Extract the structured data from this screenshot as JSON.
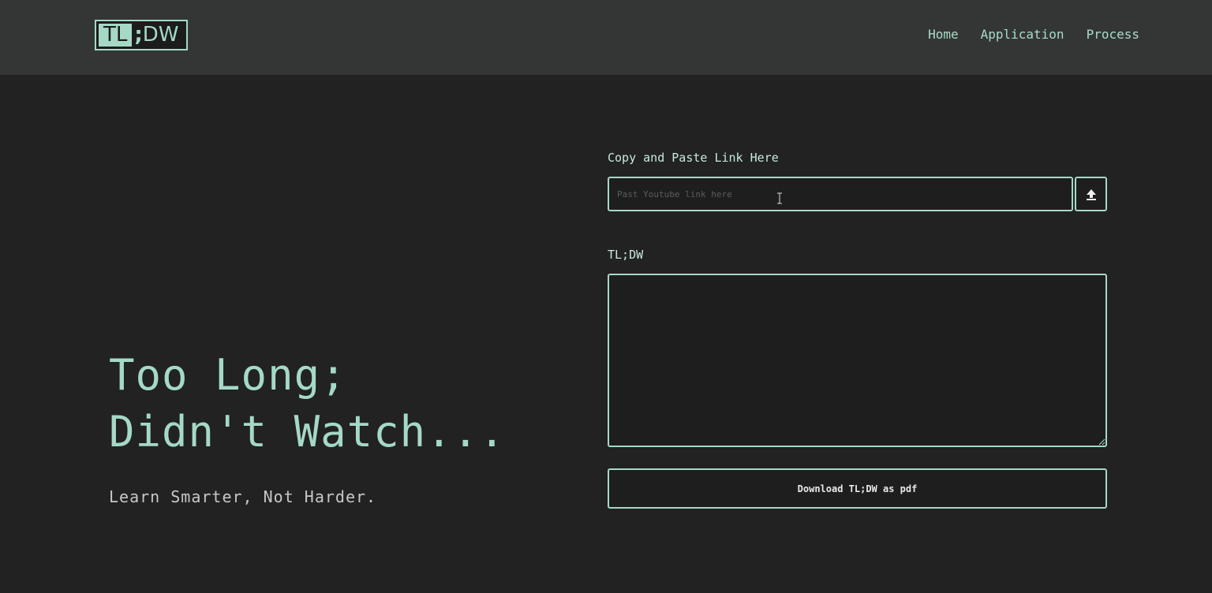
{
  "header": {
    "logo": {
      "left": "TL",
      "separator": ";",
      "right": "DW"
    },
    "nav": [
      "Home",
      "Application",
      "Process"
    ]
  },
  "hero": {
    "title": "Too Long;\nDidn't Watch...",
    "subtitle": "Learn Smarter, Not Harder."
  },
  "form": {
    "link_label": "Copy and Paste Link Here",
    "link_placeholder": "Past Youtube link here",
    "link_value": "",
    "upload_icon": "upload-arrow-icon",
    "summary_label": "TL;DW",
    "summary_value": "",
    "download_label": "Download TL;DW as pdf"
  },
  "colors": {
    "accent": "#a5d9c6",
    "header_bg": "#343635",
    "page_bg": "#222222"
  }
}
